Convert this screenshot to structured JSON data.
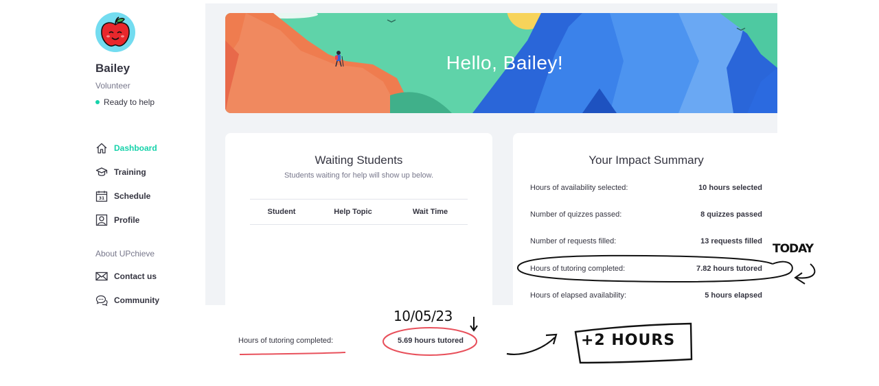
{
  "profile": {
    "name": "Bailey",
    "role": "Volunteer",
    "status": "Ready to help"
  },
  "nav": {
    "items": [
      {
        "label": "Dashboard",
        "icon": "home-icon",
        "active": true
      },
      {
        "label": "Training",
        "icon": "graduation-cap-icon",
        "active": false
      },
      {
        "label": "Schedule",
        "icon": "calendar-icon",
        "active": false
      },
      {
        "label": "Profile",
        "icon": "profile-icon",
        "active": false
      }
    ],
    "section_label": "About UPchieve",
    "about_items": [
      {
        "label": "Contact us",
        "icon": "mail-icon"
      },
      {
        "label": "Community",
        "icon": "chat-bubbles-icon"
      }
    ]
  },
  "banner": {
    "greeting": "Hello, Bailey!"
  },
  "waiting": {
    "title": "Waiting Students",
    "subtitle": "Students waiting for help will show up below.",
    "columns": [
      "Student",
      "Help Topic",
      "Wait Time"
    ]
  },
  "impact": {
    "title": "Your Impact Summary",
    "rows": [
      {
        "label": "Hours of availability selected:",
        "value": "10 hours selected"
      },
      {
        "label": "Number of quizzes passed:",
        "value": "8 quizzes passed"
      },
      {
        "label": "Number of requests filled:",
        "value": "13 requests filled"
      },
      {
        "label": "Hours of tutoring completed:",
        "value": "7.82 hours tutored"
      },
      {
        "label": "Hours of elapsed availability:",
        "value": "5 hours elapsed"
      }
    ]
  },
  "annotation": {
    "previous_label": "Hours of tutoring completed:",
    "previous_value": "5.69 hours tutored",
    "date_note": "10/05/23",
    "today_note": "TODAY",
    "delta_note": "+2 HOURS"
  },
  "colors": {
    "accent": "#16d2aa",
    "page_bg": "#f1f3f6",
    "annotation_red": "#e8505b"
  }
}
